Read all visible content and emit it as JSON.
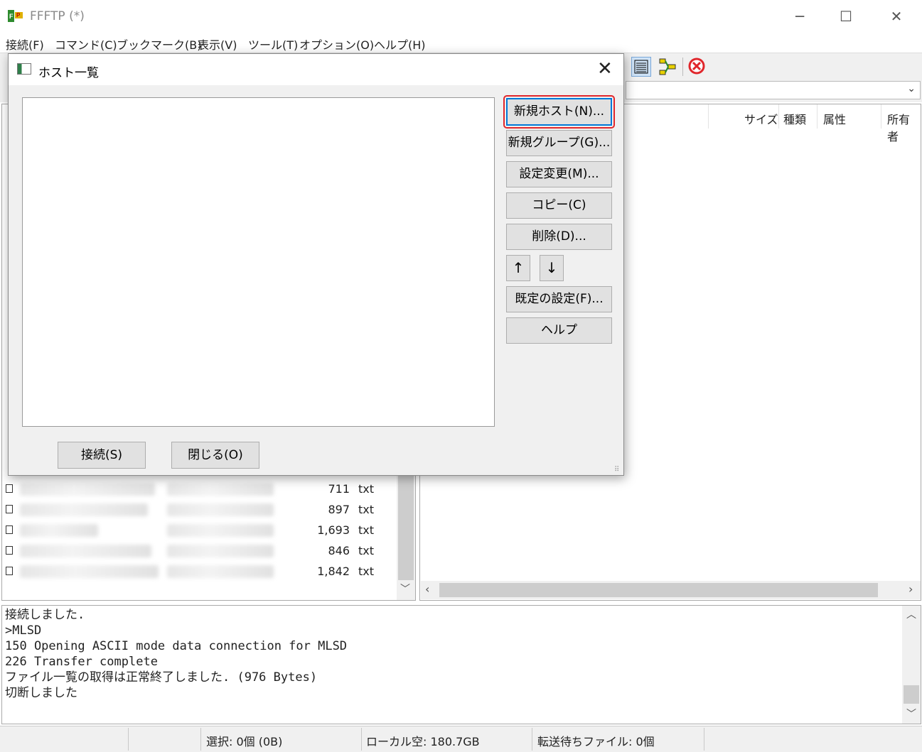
{
  "window": {
    "title": "FFFTP (*)",
    "controls": {
      "minimize": "─",
      "maximize": "☐",
      "close": "✕"
    }
  },
  "menu": [
    "接続(F)",
    "コマンド(C)",
    "ブックマーク(B)",
    "表示(V)",
    "ツール(T)",
    "オプション(O)",
    "ヘルプ(H)"
  ],
  "right_pane": {
    "columns": [
      "サイズ",
      "種類",
      "属性",
      "所有者"
    ]
  },
  "left_pane": {
    "files": [
      {
        "size": "711",
        "type": "txt"
      },
      {
        "size": "897",
        "type": "txt"
      },
      {
        "size": "1,693",
        "type": "txt"
      },
      {
        "size": "846",
        "type": "txt"
      },
      {
        "size": "1,842",
        "type": "txt"
      }
    ]
  },
  "log": [
    "接続しました.",
    ">MLSD",
    "150 Opening ASCII mode data connection for MLSD",
    "226 Transfer complete",
    "ファイル一覧の取得は正常終了しました. (976 Bytes)",
    "切断しました"
  ],
  "status": {
    "selection": "選択: 0個 (0B)",
    "local_free": "ローカル空: 180.7GB",
    "queue": "転送待ちファイル: 0個"
  },
  "dialog": {
    "title": "ホスト一覧",
    "close": "✕",
    "buttons": {
      "new_host": "新規ホスト(N)...",
      "new_group": "新規グループ(G)...",
      "edit": "設定変更(M)...",
      "copy": "コピー(C)",
      "delete": "削除(D)...",
      "up": "↑",
      "down": "↓",
      "defaults": "既定の設定(F)...",
      "help": "ヘルプ",
      "connect": "接続(S)",
      "close": "閉じる(O)"
    }
  },
  "colors": {
    "highlight_border": "#e0262b",
    "default_button_border": "#0078d7",
    "stop_icon": "#e0262b"
  }
}
